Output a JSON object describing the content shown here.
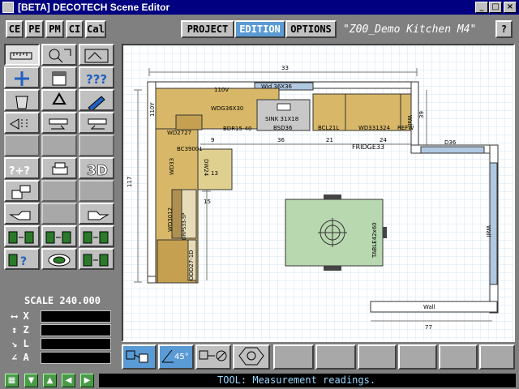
{
  "window": {
    "title": "[BETA] DECOTECH Scene Editor",
    "min": "_",
    "max": "□",
    "close": "×"
  },
  "topbar": {
    "left_buttons": [
      "CE",
      "PE",
      "PM",
      "CI",
      "Cal"
    ],
    "modes": [
      "PROJECT",
      "EDITION",
      "OPTIONS"
    ],
    "active_mode": "EDITION",
    "project_title": "\"Z00_Demo Kitchen  M4\"",
    "help": "?"
  },
  "left_panel": {
    "tool_icons": [
      "measure-icon",
      "zoom-extents-icon",
      "view-fit-icon",
      "add-icon",
      "cabinet-icon",
      "query-icon",
      "delete-icon",
      "recycle-icon",
      "edit-icon",
      "align-icon",
      "undo-icon",
      "redo-icon",
      "empty",
      "empty",
      "empty",
      "add-query-icon",
      "print-icon",
      "3d-icon",
      "paint-icon",
      "empty",
      "empty",
      "hand-left-icon",
      "empty",
      "hand-right-icon",
      "grid-move-icon",
      "grid-copy-icon",
      "grid-swap-icon",
      "grid-query-icon",
      "layer-icon",
      "grid-group-icon"
    ],
    "label_3d": "3D",
    "scale_label": "SCALE 240.000",
    "readouts": [
      {
        "icon": "arrow-horizontal-icon",
        "label": "X",
        "value": ""
      },
      {
        "icon": "arrow-vertical-icon",
        "label": "Z",
        "value": ""
      },
      {
        "icon": "length-icon",
        "label": "L",
        "value": ""
      },
      {
        "icon": "angle-icon",
        "label": "A",
        "value": ""
      }
    ]
  },
  "plan": {
    "labels": {
      "dim_top": "33",
      "dim_left": "117",
      "dim_bottom": "77",
      "dim_right": "39",
      "d110v": "110V",
      "d110y": "110Y",
      "wall_top": "Wid 36X36",
      "wdg": "WDG36X30",
      "sink": "SINK 31X18",
      "b": "BSD36",
      "bdr": "BDR15-40",
      "wd2727": "WD2727",
      "bcl": "BCL21L",
      "wd33": "WD331324",
      "refw": "REFW",
      "fridge": "FRIDGE33",
      "bc": "BC39001",
      "wd33l": "WD33",
      "dw": "DW24",
      "wd3012": "WD3012",
      "pantry": "DRPS33-5P",
      "odd": "ODD27-1D",
      "wall_right": "Wall",
      "wall_bottom": "Wall",
      "wall_end": "Wall",
      "d36": "D36",
      "table": "TABLE42x60",
      "d36x": "36",
      "d21": "21",
      "d24": "24",
      "d13": "13",
      "d15": "15",
      "d9": "9"
    }
  },
  "bottom_tools": {
    "icons": [
      "snap-grid-icon",
      "angle-45-icon",
      "no-snap-icon",
      "object-snap-icon",
      "empty",
      "empty",
      "empty",
      "empty"
    ],
    "angle_label": "45°"
  },
  "statusbar": {
    "nav_icons": [
      "grid-icon",
      "arrow-down-icon",
      "arrow-up-icon",
      "arrow-left-icon",
      "arrow-right-icon"
    ],
    "tool_text": "TOOL: Measurement readings."
  },
  "colors": {
    "accent": "#5b9bd5",
    "cabinet": "#d8b868",
    "countertop": "#c8c8c8",
    "table": "#b8d8b0",
    "window": "#b0c8e0"
  }
}
